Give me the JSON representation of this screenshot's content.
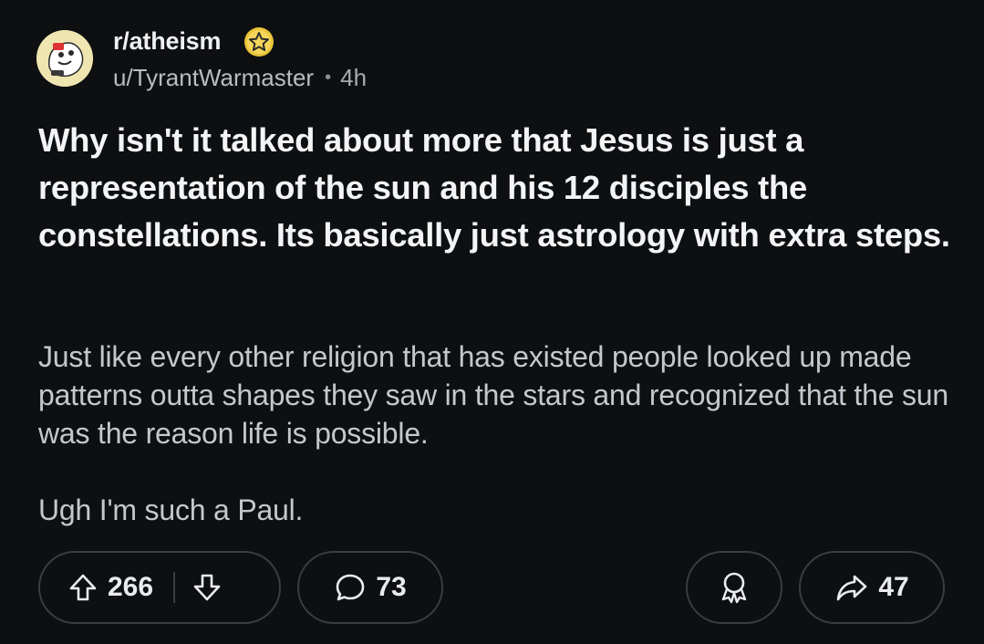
{
  "post": {
    "subreddit": "r/atheism",
    "author": "u/TyrantWarmaster",
    "separator": "•",
    "time": "4h",
    "title": "Why isn't it talked about more that Jesus is just a representation of the sun and his 12 disciples the constellations. Its basically just astrology with extra steps.",
    "body": [
      "Just like every other religion that has existed people looked up made patterns outta shapes they saw in the stars and recognized that the sun was the reason life is possible.",
      "Ugh I'm such a Paul."
    ]
  },
  "actions": {
    "upvotes": "266",
    "comments": "73",
    "shares": "47"
  },
  "icons": {
    "avatar": "subreddit-avatar",
    "award": "star-badge-icon",
    "upvote": "arrow-up-icon",
    "downvote": "arrow-down-icon",
    "comment": "speech-bubble-icon",
    "give_award": "award-ribbon-icon",
    "share": "share-arrow-icon"
  },
  "colors": {
    "background": "#0e0f11",
    "title": "#f3f4f6",
    "body": "#c4c8cd",
    "meta": "#b9bcc0",
    "pill_border": "#3a3d42",
    "award_gold": "#e9c33a"
  }
}
